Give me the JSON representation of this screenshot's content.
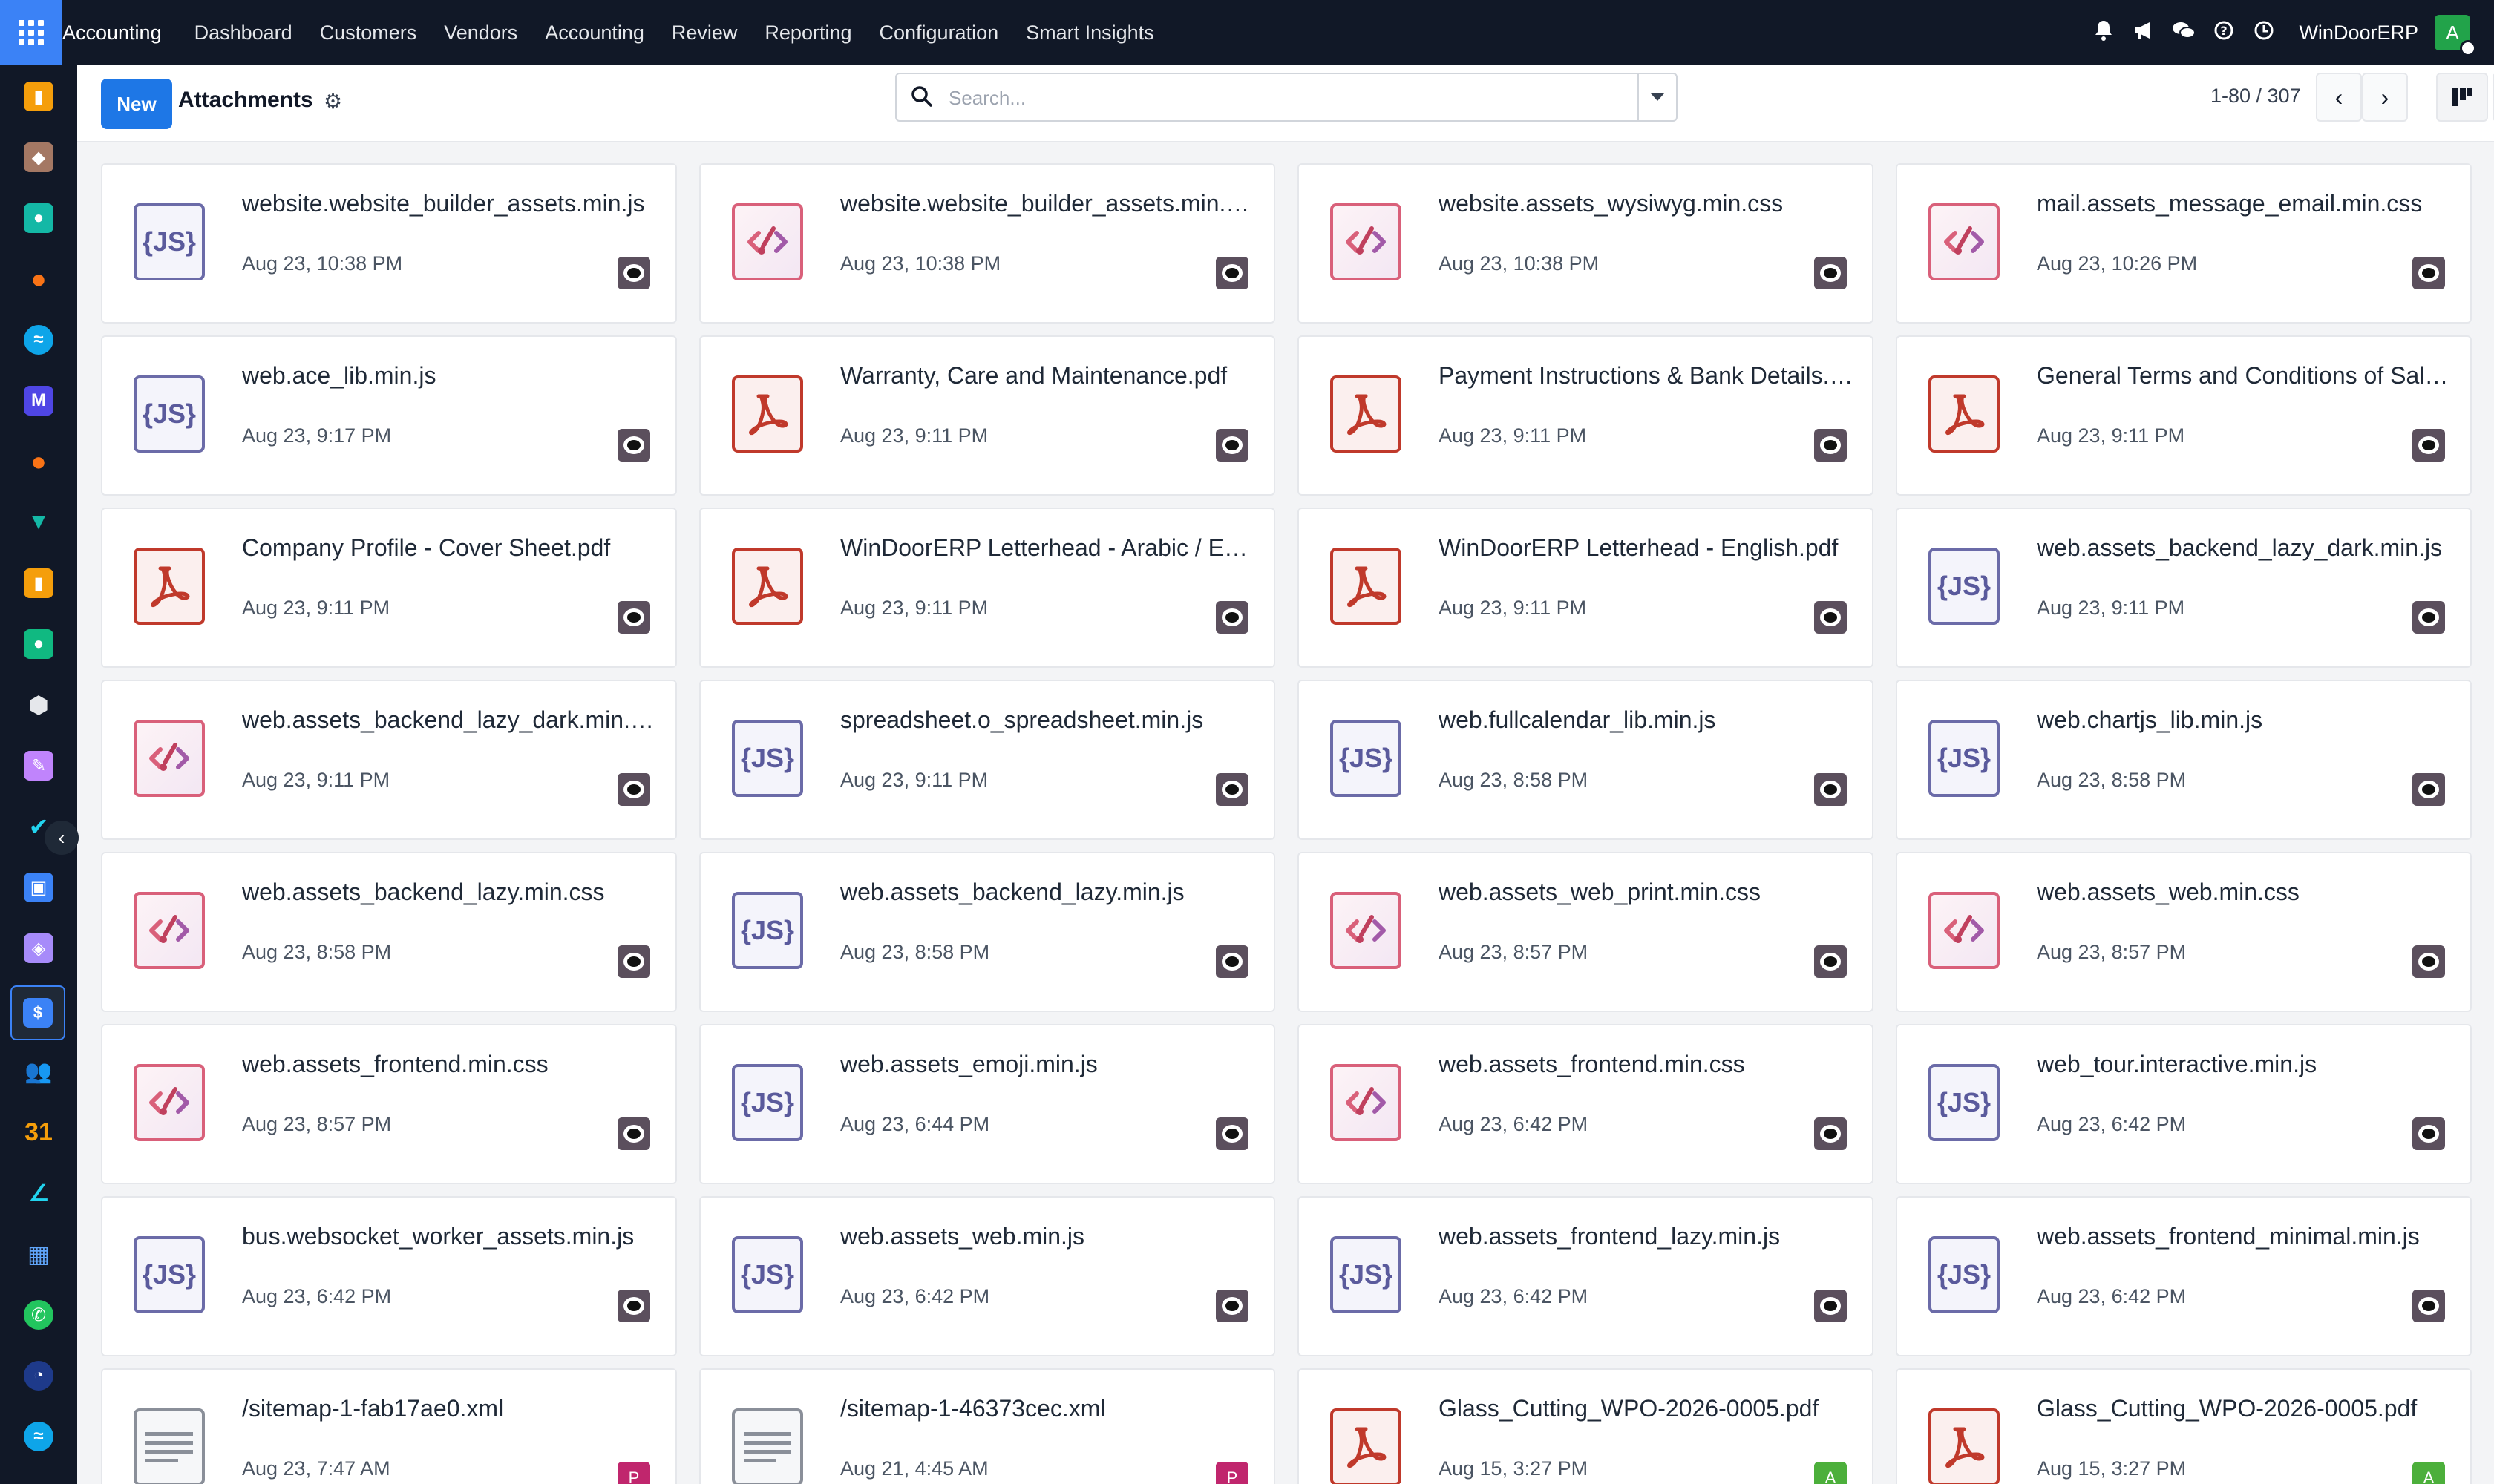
{
  "topbar": {
    "brand": "Accounting",
    "menu": [
      "Dashboard",
      "Customers",
      "Vendors",
      "Accounting",
      "Review",
      "Reporting",
      "Configuration",
      "Smart Insights"
    ],
    "company": "WinDoorERP",
    "user_initial": "A"
  },
  "control": {
    "new_label": "New",
    "title": "Attachments",
    "search_placeholder": "Search...",
    "pager": "1-80 / 307"
  },
  "rail": {
    "toggle": "‹"
  },
  "cards": [
    {
      "title": "website.website_builder_assets.min.js",
      "date": "Aug 23, 10:38 PM",
      "type": "js",
      "avatar": "bot"
    },
    {
      "title": "website.website_builder_assets.min.css",
      "date": "Aug 23, 10:38 PM",
      "type": "css",
      "avatar": "bot"
    },
    {
      "title": "website.assets_wysiwyg.min.css",
      "date": "Aug 23, 10:38 PM",
      "type": "css",
      "avatar": "bot"
    },
    {
      "title": "mail.assets_message_email.min.css",
      "date": "Aug 23, 10:26 PM",
      "type": "css",
      "avatar": "bot"
    },
    {
      "title": "web.ace_lib.min.js",
      "date": "Aug 23, 9:17 PM",
      "type": "js",
      "avatar": "bot"
    },
    {
      "title": "Warranty, Care and Maintenance.pdf",
      "date": "Aug 23, 9:11 PM",
      "type": "pdf",
      "avatar": "bot"
    },
    {
      "title": "Payment Instructions & Bank Details.pdf",
      "date": "Aug 23, 9:11 PM",
      "type": "pdf",
      "avatar": "bot"
    },
    {
      "title": "General Terms and Conditions of Sale.pdf",
      "date": "Aug 23, 9:11 PM",
      "type": "pdf",
      "avatar": "bot"
    },
    {
      "title": "Company Profile - Cover Sheet.pdf",
      "date": "Aug 23, 9:11 PM",
      "type": "pdf",
      "avatar": "bot"
    },
    {
      "title": "WinDoorERP Letterhead - Arabic / English.pdf",
      "date": "Aug 23, 9:11 PM",
      "type": "pdf",
      "avatar": "bot"
    },
    {
      "title": "WinDoorERP Letterhead - English.pdf",
      "date": "Aug 23, 9:11 PM",
      "type": "pdf",
      "avatar": "bot"
    },
    {
      "title": "web.assets_backend_lazy_dark.min.js",
      "date": "Aug 23, 9:11 PM",
      "type": "js",
      "avatar": "bot"
    },
    {
      "title": "web.assets_backend_lazy_dark.min.css",
      "date": "Aug 23, 9:11 PM",
      "type": "css",
      "avatar": "bot"
    },
    {
      "title": "spreadsheet.o_spreadsheet.min.js",
      "date": "Aug 23, 9:11 PM",
      "type": "js",
      "avatar": "bot"
    },
    {
      "title": "web.fullcalendar_lib.min.js",
      "date": "Aug 23, 8:58 PM",
      "type": "js",
      "avatar": "bot"
    },
    {
      "title": "web.chartjs_lib.min.js",
      "date": "Aug 23, 8:58 PM",
      "type": "js",
      "avatar": "bot"
    },
    {
      "title": "web.assets_backend_lazy.min.css",
      "date": "Aug 23, 8:58 PM",
      "type": "css",
      "avatar": "bot"
    },
    {
      "title": "web.assets_backend_lazy.min.js",
      "date": "Aug 23, 8:58 PM",
      "type": "js",
      "avatar": "bot"
    },
    {
      "title": "web.assets_web_print.min.css",
      "date": "Aug 23, 8:57 PM",
      "type": "css",
      "avatar": "bot"
    },
    {
      "title": "web.assets_web.min.css",
      "date": "Aug 23, 8:57 PM",
      "type": "css",
      "avatar": "bot"
    },
    {
      "title": "web.assets_frontend.min.css",
      "date": "Aug 23, 8:57 PM",
      "type": "css",
      "avatar": "bot"
    },
    {
      "title": "web.assets_emoji.min.js",
      "date": "Aug 23, 6:44 PM",
      "type": "js",
      "avatar": "bot"
    },
    {
      "title": "web.assets_frontend.min.css",
      "date": "Aug 23, 6:42 PM",
      "type": "css",
      "avatar": "bot"
    },
    {
      "title": "web_tour.interactive.min.js",
      "date": "Aug 23, 6:42 PM",
      "type": "js",
      "avatar": "bot"
    },
    {
      "title": "bus.websocket_worker_assets.min.js",
      "date": "Aug 23, 6:42 PM",
      "type": "js",
      "avatar": "bot"
    },
    {
      "title": "web.assets_web.min.js",
      "date": "Aug 23, 6:42 PM",
      "type": "js",
      "avatar": "bot"
    },
    {
      "title": "web.assets_frontend_lazy.min.js",
      "date": "Aug 23, 6:42 PM",
      "type": "js",
      "avatar": "bot"
    },
    {
      "title": "web.assets_frontend_minimal.min.js",
      "date": "Aug 23, 6:42 PM",
      "type": "js",
      "avatar": "bot"
    },
    {
      "title": "/sitemap-1-fab17ae0.xml",
      "date": "Aug 23, 7:47 AM",
      "type": "xml",
      "avatar": "P"
    },
    {
      "title": "/sitemap-1-46373cec.xml",
      "date": "Aug 21, 4:45 AM",
      "type": "xml",
      "avatar": "P"
    },
    {
      "title": "Glass_Cutting_WPO-2026-0005.pdf",
      "date": "Aug 15, 3:27 PM",
      "type": "pdf",
      "avatar": "A"
    },
    {
      "title": "Glass_Cutting_WPO-2026-0005.pdf",
      "date": "Aug 15, 3:27 PM",
      "type": "pdf",
      "avatar": "A"
    }
  ],
  "js_icon_text": "{JS}",
  "colors": {
    "accent": "#1e77e6",
    "nav_bg": "#111827",
    "pdf": "#c0392b",
    "css": "#d9607a",
    "js": "#6b6ba8"
  }
}
